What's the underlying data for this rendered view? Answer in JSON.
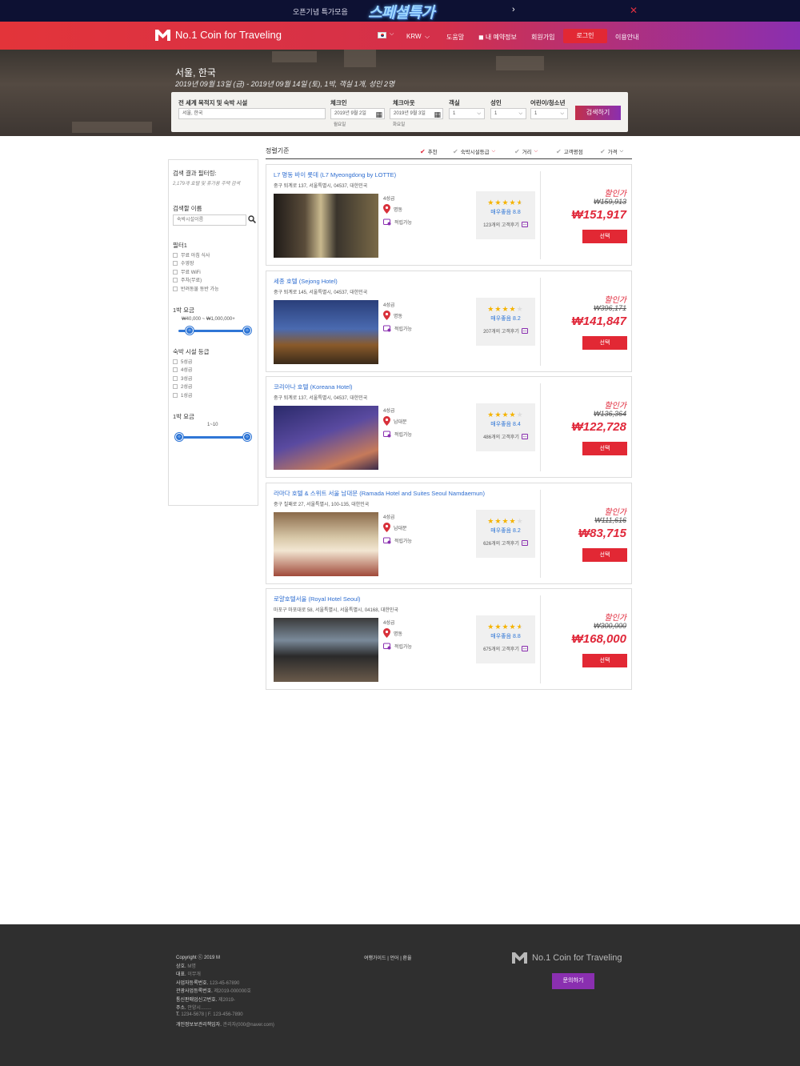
{
  "promo": {
    "text": "오픈기념 특가모음",
    "logo": "스페셜특가",
    "next_icon": "chevron-right-icon",
    "close_icon": "close-icon"
  },
  "nav": {
    "brand": "No.1 Coin for Traveling",
    "currency": "KRW",
    "help": "도움말",
    "my_booking": "내 예약정보",
    "signup": "회원가입",
    "login": "로그인",
    "guide": "이용안내"
  },
  "hero": {
    "title": "서울, 한국",
    "subtitle": "2019년 09월 13일 (금) - 2019년 09월 14일 (토), 1박, 객실 1개, 성인 2명"
  },
  "search": {
    "dest_label": "전 세계 목적지 및 숙박 시설",
    "dest_value": "서울, 한국",
    "checkin_label": "체크인",
    "checkin_value": "2019년 9월 2일",
    "checkin_day": "월요일",
    "checkout_label": "체크아웃",
    "checkout_value": "2019년 9월 3일",
    "checkout_day": "화요일",
    "rooms_label": "객실",
    "rooms_value": "1",
    "adults_label": "성인",
    "adults_value": "1",
    "kids_label": "어린이/청소년",
    "kids_value": "1",
    "button": "검색하기"
  },
  "sidebar": {
    "result_title": "검색 결과 필터링:",
    "result_note": "2,179개 호텔 및 휴가용 주택 검색",
    "name_title": "검색할 이름",
    "name_placeholder": "숙박시설이름",
    "filter_title": "필터1",
    "filters": [
      "무료 아침 식사",
      "수영장",
      "무료 WiFi",
      "주차(무료)",
      "반려동물 동반 가능"
    ],
    "price_title": "1박 요금",
    "price_range": "₩40,000 ~ ₩1,000,000+",
    "grade_title": "숙박 시설 등급",
    "grades": [
      "5성급",
      "4성급",
      "3성급",
      "2성급",
      "1성급"
    ],
    "price2_title": "1박 요금",
    "range2": "1~10"
  },
  "sort": {
    "title": "정렬기준",
    "items": [
      "추천",
      "숙박시설등급",
      "거리",
      "고객평점",
      "가격"
    ]
  },
  "hotels": [
    {
      "name": "L7 명동 바이 롯데 (L7 Myeongdong by LOTTE)",
      "address": "중구 퇴계로 137, 서울특별시, 04537, 대한민국",
      "grade": "4성급",
      "location": "명동",
      "points": "적립가능",
      "stars": 4.5,
      "score": "매우좋음 8.8",
      "reviews": "123개의 고객후기",
      "discount": "할인가",
      "original": "₩159,913",
      "price": "₩151,917",
      "select": "선택"
    },
    {
      "name": "세종 호텔 (Sejong Hotel)",
      "address": "중구 퇴계로 145, 서울특별시, 04537, 대한민국",
      "grade": "4성급",
      "location": "명동",
      "points": "적립가능",
      "stars": 4,
      "score": "매우좋음 8.2",
      "reviews": "207개의 고객후기",
      "discount": "할인가",
      "original": "₩396,171",
      "price": "₩141,847",
      "select": "선택"
    },
    {
      "name": "코리아나 호텔 (Koreana Hotel)",
      "address": "중구 퇴계로 137, 서울특별시, 04537, 대한민국",
      "grade": "4성급",
      "location": "남대문",
      "points": "적립가능",
      "stars": 4,
      "score": "매우좋음 8.4",
      "reviews": "486개의 고객후기",
      "discount": "할인가",
      "original": "₩136,364",
      "price": "₩122,728",
      "select": "선택"
    },
    {
      "name": "라마다 호텔 & 스위트 서울 남대문 (Ramada Hotel and Suites Seoul Namdaemun)",
      "address": "중구 칠패로 27, 서울특별시, 100-135, 대한민국",
      "grade": "4성급",
      "location": "남대문",
      "points": "적립가능",
      "stars": 4,
      "score": "매우좋음 8.2",
      "reviews": "626개의 고객후기",
      "discount": "할인가",
      "original": "₩111,616",
      "price": "₩83,715",
      "select": "선택"
    },
    {
      "name": "로얄호텔서울 (Royal Hotel Seoul)",
      "address": "마포구 마포대로 58, 서울특별시, 서울특별시, 04168, 대한민국",
      "grade": "4성급",
      "location": "명동",
      "points": "적립가능",
      "stars": 4.5,
      "score": "매우좋음 8.8",
      "reviews": "675개의 고객후기",
      "discount": "할인가",
      "original": "₩300,000",
      "price": "₩168,000",
      "select": "선택"
    }
  ],
  "footer": {
    "lines": [
      {
        "k": "Copyright ⓒ 2019 M",
        "v": ""
      },
      {
        "k": "상호.",
        "v": "M명"
      },
      {
        "k": "대표.",
        "v": "이무개"
      },
      {
        "k": "사업자등록번호.",
        "v": "123-45-67890"
      },
      {
        "k": "관광사업등록번호.",
        "v": "제2019-000000호"
      },
      {
        "k": "통신판매업신고번호.",
        "v": "제2019-"
      },
      {
        "k": "주소.",
        "v": "안양시........"
      },
      {
        "k": "T.",
        "v": "1234-5678   |   F. 123-456-7890"
      },
      {
        "k": "개인정보보관리책임자.",
        "v": "관리자(000@naver.com)"
      }
    ],
    "links": "여행가이드  |  언어  |  환율",
    "brand": "No.1 Coin for Traveling",
    "contact": "문의하기"
  },
  "colors": {
    "accent_red": "#e22834",
    "accent_purple": "#8a2fb0",
    "link_blue": "#2f6ed0"
  }
}
